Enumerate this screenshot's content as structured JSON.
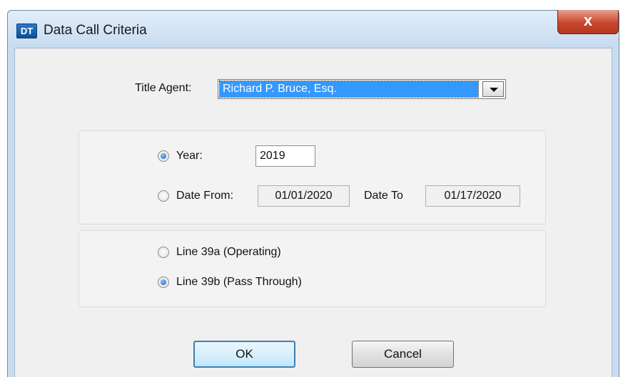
{
  "window": {
    "title": "Data Call Criteria",
    "app_icon": "DT",
    "close_glyph": "x"
  },
  "title_agent": {
    "label": "Title Agent:",
    "selected": "Richard P. Bruce, Esq."
  },
  "period": {
    "year_label": "Year:",
    "year_value": "2019",
    "year_checked": true,
    "date_from_label": "Date From:",
    "date_from_value": "01/01/2020",
    "date_to_label": "Date To",
    "date_to_value": "01/17/2020",
    "date_range_checked": false
  },
  "line_options": {
    "line_39a_label": "Line 39a (Operating)",
    "line_39a_checked": false,
    "line_39b_label": "Line 39b (Pass Through)",
    "line_39b_checked": true
  },
  "buttons": {
    "ok": "OK",
    "cancel": "Cancel"
  },
  "colors": {
    "selection": "#3399ff",
    "close_button": "#c7462c",
    "default_button_border": "#3c7fb1"
  }
}
